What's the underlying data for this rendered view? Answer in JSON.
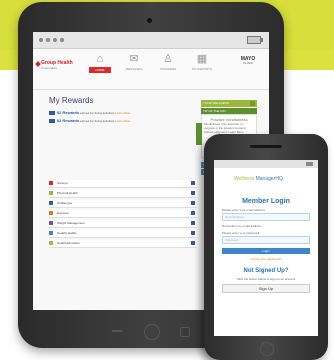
{
  "colors": {
    "band": "#d6df3b",
    "accent_red": "#d62b2b",
    "link_blue": "#2e72b3",
    "green": "#97b83a"
  },
  "tablet": {
    "logo": {
      "name": "Group Health",
      "sub": "Cooperative"
    },
    "nav": [
      {
        "label": "HOME",
        "icon": "home-icon"
      },
      {
        "label": "MESSAGES",
        "icon": "messages-icon"
      },
      {
        "label": "TRACKERS",
        "icon": "trackers-icon"
      },
      {
        "label": "MY REPORTS",
        "icon": "reports-icon"
      }
    ],
    "mayo": {
      "title": "MAYO",
      "sub": "CLINIC"
    },
    "rewards": {
      "title": "My Rewards",
      "lines": [
        {
          "amount": "$2 Rewards",
          "note": "earned for doing activities",
          "link": "Learn More"
        },
        {
          "amount": "$2 Rewards",
          "note": "earned for doing activities",
          "link": "Learn More"
        }
      ]
    },
    "panel": {
      "head": "YOUR WELLNESS",
      "sub": "TIP OF THE DAY",
      "body_title": "Practice mindfulness",
      "body_text": "Mindfulness. Pay attention on purpose in the present moment, without judgment. Learn More",
      "btn1": "TRY AN APP",
      "btn2": "MY STATS"
    },
    "list": [
      {
        "label": "Surveys",
        "color": "#d62b2b"
      },
      {
        "label": "Physical Health",
        "color": "#97b83a"
      },
      {
        "label": "Challenges",
        "color": "#3a5a98"
      },
      {
        "label": "Exercise",
        "color": "#e07b1b"
      },
      {
        "label": "Weight Management",
        "color": "#7a4d9b"
      },
      {
        "label": "Healthy Habits",
        "color": "#3b86c6"
      },
      {
        "label": "Health Education",
        "color": "#9ac33b"
      }
    ]
  },
  "phone": {
    "logo": {
      "brand": "Wellness",
      "suffix": "ManagerHQ"
    },
    "title": "Member Login",
    "email_label": "Please enter your email address",
    "email_placeholder": "Email Address",
    "remember_label": "Remember my email address",
    "password_label": "Please enter your password",
    "password_placeholder": "Password",
    "login_button": "Login",
    "forgot_link": "Forgot your password?",
    "signup_title": "Not Signed Up?",
    "signup_note": "Click the button below to sign up an account",
    "signup_button": "Sign Up"
  }
}
